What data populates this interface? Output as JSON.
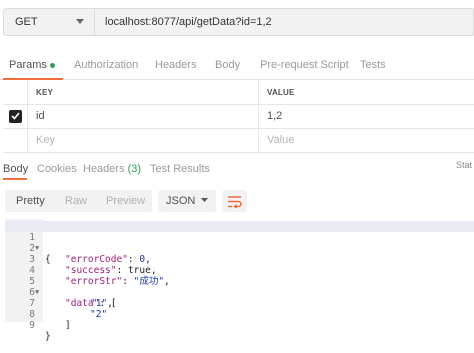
{
  "request": {
    "method": "GET",
    "url": "localhost:8077/api/getData?id=1,2"
  },
  "request_tabs": [
    {
      "label": "Params",
      "active": true,
      "has_dot": true
    },
    {
      "label": "Authorization",
      "active": false
    },
    {
      "label": "Headers",
      "active": false
    },
    {
      "label": "Body",
      "active": false
    },
    {
      "label": "Pre-request Script",
      "active": false
    },
    {
      "label": "Tests",
      "active": false
    }
  ],
  "params": {
    "key_header": "KEY",
    "value_header": "VALUE",
    "rows": [
      {
        "checked": true,
        "key": "id",
        "value": "1,2"
      }
    ],
    "new_row": {
      "key_placeholder": "Key",
      "value_placeholder": "Value"
    }
  },
  "response_tabs": [
    {
      "label": "Body",
      "active": true
    },
    {
      "label": "Cookies",
      "active": false
    },
    {
      "label": "Headers",
      "count": "(3)",
      "active": false
    },
    {
      "label": "Test Results",
      "active": false
    }
  ],
  "status_text": "Stat",
  "view_modes": [
    "Pretty",
    "Raw",
    "Preview"
  ],
  "active_view": "Pretty",
  "format": "JSON",
  "code_lines": [
    {
      "n": "1",
      "fold": true,
      "highlight": true
    },
    {
      "n": "2"
    },
    {
      "n": "3"
    },
    {
      "n": "4"
    },
    {
      "n": "5",
      "fold": true
    },
    {
      "n": "6"
    },
    {
      "n": "7"
    },
    {
      "n": "8"
    },
    {
      "n": "9"
    }
  ],
  "json": {
    "open_brace": "{",
    "errorCode_key": "\"errorCode\"",
    "errorCode_val": "0",
    "success_key": "\"success\"",
    "success_val": "true",
    "errorStr_key": "\"errorStr\"",
    "errorStr_val": "\"成功\"",
    "data_key": "\"data\"",
    "open_bracket": "[",
    "item1": "\"1\"",
    "item2": "\"2\"",
    "close_bracket": "]",
    "close_brace": "}"
  },
  "colors": {
    "accent": "#f26b3a",
    "green": "#2aa350",
    "json_key": "#a11d7b",
    "json_value": "#1b3aa6"
  }
}
